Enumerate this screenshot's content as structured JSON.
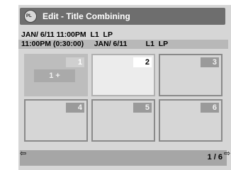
{
  "header": {
    "disc_label": "PL",
    "title": "Edit - Title Combining"
  },
  "info": {
    "line1": "JAN/ 6/11 11:00PM  L1  LP",
    "line2": "11:00PM (0:30:00)     JAN/ 6/11         L1  LP"
  },
  "titles": [
    {
      "number": "1",
      "state": "first",
      "label": "1 +"
    },
    {
      "number": "2",
      "state": "selected"
    },
    {
      "number": "3",
      "state": "normal"
    },
    {
      "number": "4",
      "state": "normal"
    },
    {
      "number": "5",
      "state": "normal"
    },
    {
      "number": "6",
      "state": "normal"
    }
  ],
  "nav": {
    "left_arrow": "⇦",
    "right_arrow": "⇨"
  },
  "footer": {
    "page_indicator": "1 / 6"
  },
  "colors": {
    "title_bar": "#6e6e6e",
    "background": "#d6d6d6",
    "footer": "#a6a6a6"
  }
}
